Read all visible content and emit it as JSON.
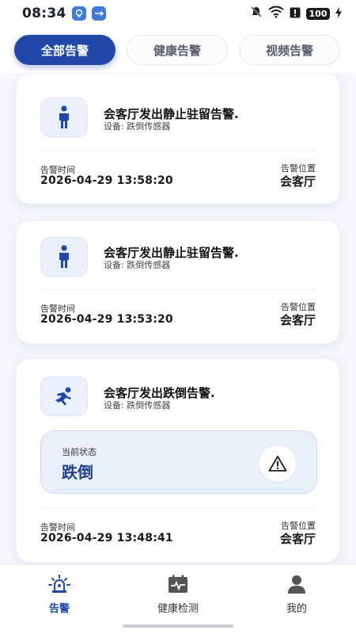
{
  "status_bar": {
    "time": "08:34",
    "battery": "100"
  },
  "tabs": [
    {
      "label": "全部告警",
      "active": true
    },
    {
      "label": "健康告警",
      "active": false
    },
    {
      "label": "视频告警",
      "active": false
    }
  ],
  "alarms": [
    {
      "title": "会客厅发出静止驻留告警.",
      "device": "设备:  跌倒传感器",
      "time_label": "告警时间",
      "time": "2026-04-29 13:58:20",
      "location_label": "告警位置",
      "location": "会客厅",
      "icon": "person-standing-icon"
    },
    {
      "title": "会客厅发出静止驻留告警.",
      "device": "设备:  跌倒传感器",
      "time_label": "告警时间",
      "time": "2026-04-29 13:53:20",
      "location_label": "告警位置",
      "location": "会客厅",
      "icon": "person-standing-icon"
    },
    {
      "title": "会客厅发出跌倒告警.",
      "device": "设备:  跌倒传感器",
      "state_label": "当前状态",
      "state": "跌倒",
      "time_label": "告警时间",
      "time": "2026-04-29 13:48:41",
      "location_label": "告警位置",
      "location": "会客厅",
      "icon": "person-falling-icon"
    }
  ],
  "bottom_nav": [
    {
      "label": "告警",
      "icon": "alarm-light-icon",
      "active": true
    },
    {
      "label": "健康检测",
      "icon": "health-monitor-icon",
      "active": false
    },
    {
      "label": "我的",
      "icon": "user-icon",
      "active": false
    }
  ],
  "colors": {
    "primary": "#1f48a8",
    "card_bg": "#ffffff",
    "page_bg": "#f4f6fb",
    "state_text": "#1f3f8f"
  }
}
